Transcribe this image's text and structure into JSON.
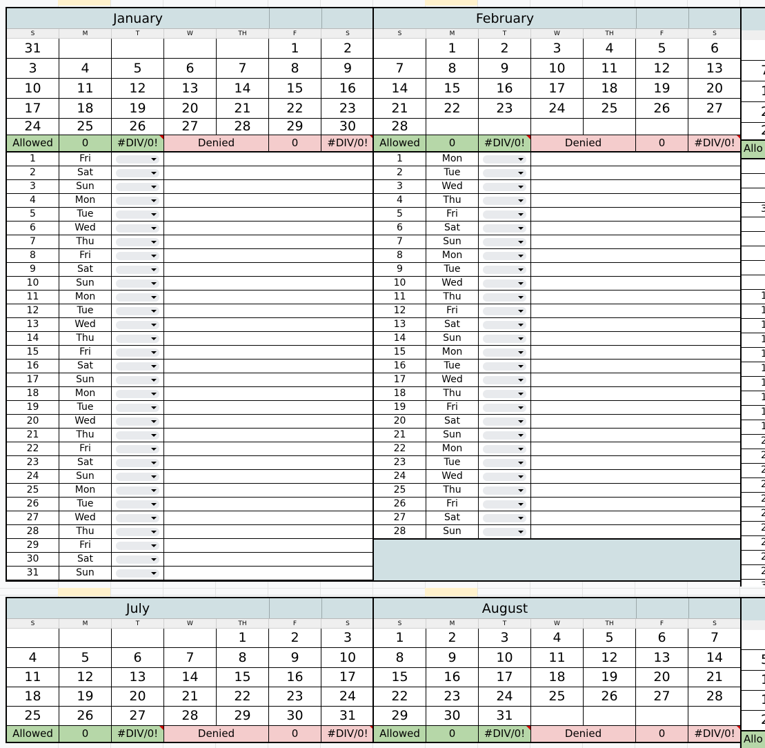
{
  "weekday_headers": [
    "S",
    "M",
    "T",
    "W",
    "TH",
    "F",
    "S"
  ],
  "summary": {
    "allowed_label": "Allowed",
    "allowed_count": "0",
    "allowed_pct": "#DIV/0!",
    "denied_label": "Denied",
    "denied_count": "0",
    "denied_pct": "#DIV/0!"
  },
  "months": {
    "january": {
      "name": "January",
      "weeks": [
        [
          "31",
          "",
          "",
          "",
          "",
          "1",
          "2"
        ],
        [
          "3",
          "4",
          "5",
          "6",
          "7",
          "8",
          "9"
        ],
        [
          "10",
          "11",
          "12",
          "13",
          "14",
          "15",
          "16"
        ],
        [
          "17",
          "18",
          "19",
          "20",
          "21",
          "22",
          "23"
        ],
        [
          "24",
          "25",
          "26",
          "27",
          "28",
          "29",
          "30"
        ]
      ],
      "days": [
        [
          "1",
          "Fri"
        ],
        [
          "2",
          "Sat"
        ],
        [
          "3",
          "Sun"
        ],
        [
          "4",
          "Mon"
        ],
        [
          "5",
          "Tue"
        ],
        [
          "6",
          "Wed"
        ],
        [
          "7",
          "Thu"
        ],
        [
          "8",
          "Fri"
        ],
        [
          "9",
          "Sat"
        ],
        [
          "10",
          "Sun"
        ],
        [
          "11",
          "Mon"
        ],
        [
          "12",
          "Tue"
        ],
        [
          "13",
          "Wed"
        ],
        [
          "14",
          "Thu"
        ],
        [
          "15",
          "Fri"
        ],
        [
          "16",
          "Sat"
        ],
        [
          "17",
          "Sun"
        ],
        [
          "18",
          "Mon"
        ],
        [
          "19",
          "Tue"
        ],
        [
          "20",
          "Wed"
        ],
        [
          "21",
          "Thu"
        ],
        [
          "22",
          "Fri"
        ],
        [
          "23",
          "Sat"
        ],
        [
          "24",
          "Sun"
        ],
        [
          "25",
          "Mon"
        ],
        [
          "26",
          "Tue"
        ],
        [
          "27",
          "Wed"
        ],
        [
          "28",
          "Thu"
        ],
        [
          "29",
          "Fri"
        ],
        [
          "30",
          "Sat"
        ],
        [
          "31",
          "Sun"
        ]
      ]
    },
    "february": {
      "name": "February",
      "weeks": [
        [
          "",
          "1",
          "2",
          "3",
          "4",
          "5",
          "6"
        ],
        [
          "7",
          "8",
          "9",
          "10",
          "11",
          "12",
          "13"
        ],
        [
          "14",
          "15",
          "16",
          "17",
          "18",
          "19",
          "20"
        ],
        [
          "21",
          "22",
          "23",
          "24",
          "25",
          "26",
          "27"
        ],
        [
          "28",
          "",
          "",
          "",
          "",
          "",
          ""
        ]
      ],
      "days": [
        [
          "1",
          "Mon"
        ],
        [
          "2",
          "Tue"
        ],
        [
          "3",
          "Wed"
        ],
        [
          "4",
          "Thu"
        ],
        [
          "5",
          "Fri"
        ],
        [
          "6",
          "Sat"
        ],
        [
          "7",
          "Sun"
        ],
        [
          "8",
          "Mon"
        ],
        [
          "9",
          "Tue"
        ],
        [
          "10",
          "Wed"
        ],
        [
          "11",
          "Thu"
        ],
        [
          "12",
          "Fri"
        ],
        [
          "13",
          "Sat"
        ],
        [
          "14",
          "Sun"
        ],
        [
          "15",
          "Mon"
        ],
        [
          "16",
          "Tue"
        ],
        [
          "17",
          "Wed"
        ],
        [
          "18",
          "Thu"
        ],
        [
          "19",
          "Fri"
        ],
        [
          "20",
          "Sat"
        ],
        [
          "21",
          "Sun"
        ],
        [
          "22",
          "Mon"
        ],
        [
          "23",
          "Tue"
        ],
        [
          "24",
          "Wed"
        ],
        [
          "25",
          "Thu"
        ],
        [
          "26",
          "Fri"
        ],
        [
          "27",
          "Sat"
        ],
        [
          "28",
          "Sun"
        ]
      ]
    },
    "july": {
      "name": "July",
      "weeks": [
        [
          "",
          "",
          "",
          "",
          "1",
          "2",
          "3"
        ],
        [
          "4",
          "5",
          "6",
          "7",
          "8",
          "9",
          "10"
        ],
        [
          "11",
          "12",
          "13",
          "14",
          "15",
          "16",
          "17"
        ],
        [
          "18",
          "19",
          "20",
          "21",
          "22",
          "23",
          "24"
        ],
        [
          "25",
          "26",
          "27",
          "28",
          "29",
          "30",
          "31"
        ]
      ]
    },
    "august": {
      "name": "August",
      "weeks": [
        [
          "1",
          "2",
          "3",
          "4",
          "5",
          "6",
          "7"
        ],
        [
          "8",
          "9",
          "10",
          "11",
          "12",
          "13",
          "14"
        ],
        [
          "15",
          "16",
          "17",
          "18",
          "19",
          "20",
          "21"
        ],
        [
          "22",
          "23",
          "24",
          "25",
          "26",
          "27",
          "28"
        ],
        [
          "29",
          "30",
          "31",
          "",
          "",
          "",
          ""
        ]
      ]
    }
  },
  "right_partial": {
    "summary_label": "Allo",
    "week_fragments": [
      "",
      "7",
      "1",
      "2",
      "2"
    ],
    "day_fragments": [
      "",
      "",
      "",
      "3",
      "",
      "",
      "",
      "",
      "",
      "1",
      "1",
      "1",
      "1",
      "1",
      "1",
      "1",
      "1",
      "1",
      "1",
      "2",
      "2",
      "2",
      "2",
      "2",
      "2",
      "2",
      "2",
      "2",
      "2",
      "3",
      "3"
    ],
    "bottom_summary_label": "Allo",
    "bottom_week_fragments": [
      "",
      "5",
      "1",
      "1",
      "2"
    ]
  }
}
